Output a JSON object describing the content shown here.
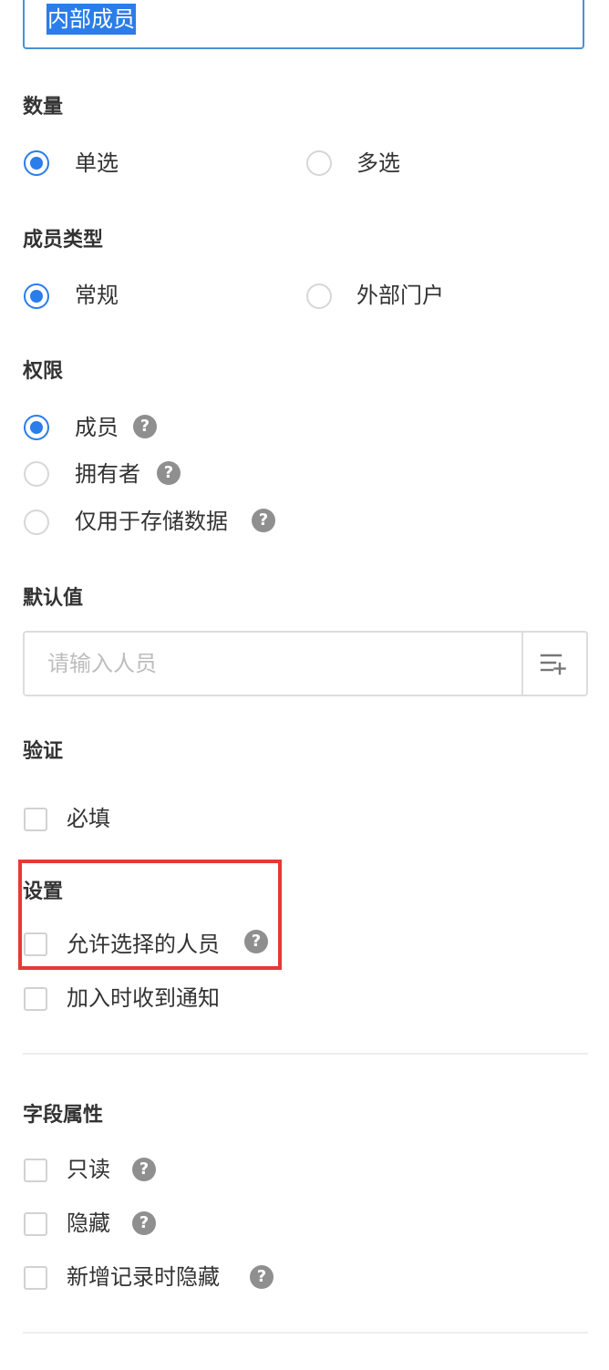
{
  "field_name": {
    "value": "内部成员"
  },
  "quantity": {
    "label": "数量",
    "options": [
      {
        "label": "单选",
        "selected": true
      },
      {
        "label": "多选",
        "selected": false
      }
    ]
  },
  "member_type": {
    "label": "成员类型",
    "options": [
      {
        "label": "常规",
        "selected": true
      },
      {
        "label": "外部门户",
        "selected": false
      }
    ]
  },
  "permission": {
    "label": "权限",
    "options": [
      {
        "label": "成员",
        "selected": true
      },
      {
        "label": "拥有者",
        "selected": false
      },
      {
        "label": "仅用于存储数据",
        "selected": false
      }
    ]
  },
  "default_value": {
    "label": "默认值",
    "placeholder": "请输入人员",
    "picker_icon": "list-add-icon"
  },
  "validation": {
    "label": "验证",
    "items": [
      {
        "label": "必填",
        "checked": false
      }
    ]
  },
  "settings": {
    "label": "设置",
    "items": [
      {
        "label": "允许选择的人员",
        "checked": false
      },
      {
        "label": "加入时收到通知",
        "checked": false
      }
    ]
  },
  "field_attributes": {
    "label": "字段属性",
    "items": [
      {
        "label": "只读",
        "checked": false
      },
      {
        "label": "隐藏",
        "checked": false
      },
      {
        "label": "新增记录时隐藏",
        "checked": false
      }
    ]
  },
  "help_icon": "?",
  "colors": {
    "accent": "#2b7de9",
    "highlight_border": "#e53935",
    "help_icon_bg": "#8f8f8f",
    "text": "#333333",
    "placeholder": "#bdbdbd"
  }
}
